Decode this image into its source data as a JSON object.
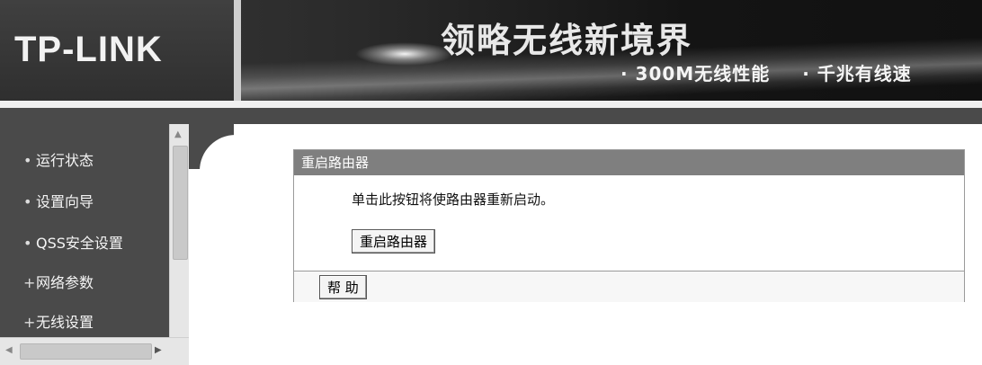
{
  "banner": {
    "logo": "TP-LINK",
    "slogan": "领略无线新境界",
    "features": [
      "· 300M无线性能",
      "· 千兆有线速"
    ]
  },
  "sidebar": {
    "items": [
      {
        "marker": "•",
        "label": "运行状态"
      },
      {
        "marker": "•",
        "label": "设置向导"
      },
      {
        "marker": "•",
        "label": "QSS安全设置"
      },
      {
        "marker": "+",
        "label": "网络参数"
      },
      {
        "marker": "+",
        "label": "无线设置"
      }
    ]
  },
  "panel": {
    "title": "重启路由器",
    "description": "单击此按钮将使路由器重新启动。",
    "reboot_label": "重启路由器",
    "help_label": "帮 助"
  },
  "colors": {
    "sidebar_bg": "#4a4a4a",
    "panel_header_bg": "#7f7f7f"
  }
}
